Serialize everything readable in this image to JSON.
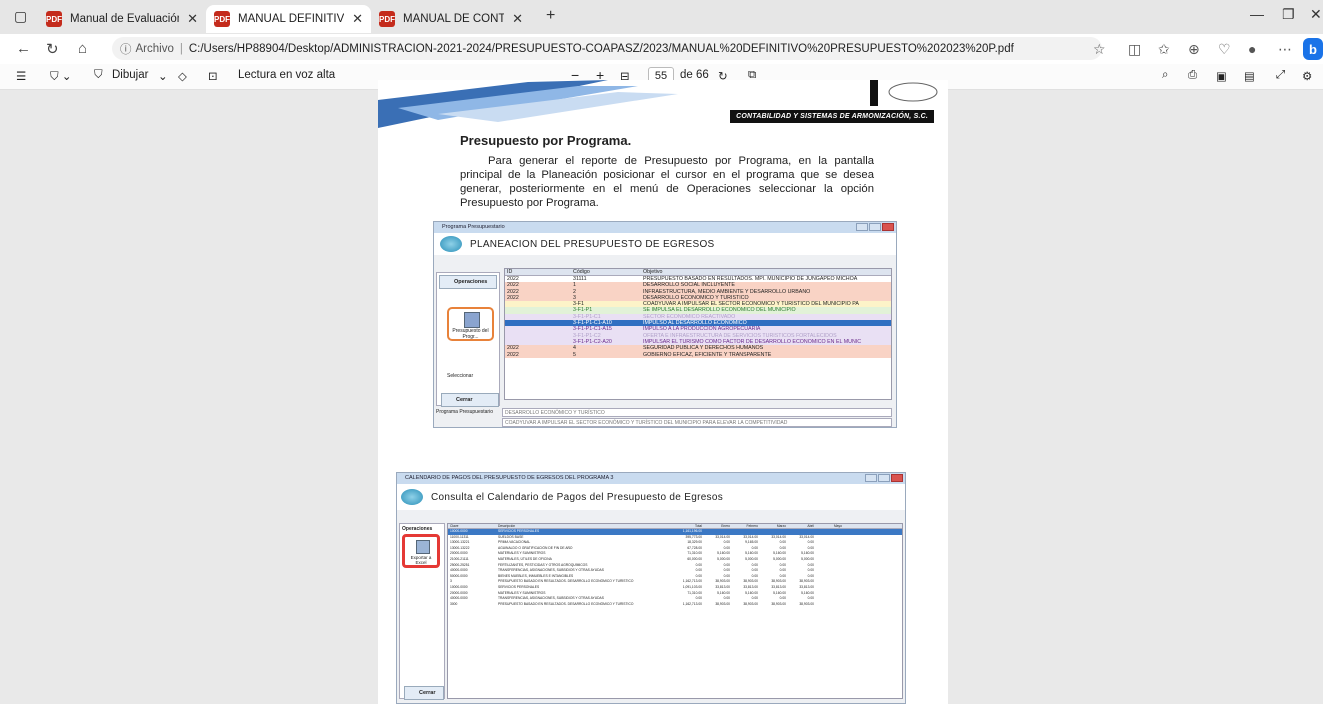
{
  "browser": {
    "tabs": [
      {
        "title": "Manual de Evaluación de Registr"
      },
      {
        "title": "MANUAL DEFINITIVO PRESUPUE"
      },
      {
        "title": "MANUAL DE CONTABILIDAD DE"
      }
    ],
    "new_tab": "+",
    "url_prefix": "Archivo",
    "url": "C:/Users/HP88904/Desktop/ADMINISTRACION-2021-2024/PRESUPUESTO-COAPASZ/2023/MANUAL%20DEFINITIVO%20PRESUPUESTO%202023%20P.pdf"
  },
  "pdf_toolbar": {
    "draw_label": "Dibujar",
    "read_aloud_label": "Lectura en voz alta",
    "zoom_out": "−",
    "zoom_in": "+",
    "current_page": "55",
    "page_total": "de 66"
  },
  "document": {
    "company_banner": "CONTABILIDAD Y SISTEMAS DE ARMONIZACIÓN, S.C.",
    "section_title": "Presupuesto por Programa.",
    "body": "Para generar el reporte de Presupuesto por Programa, en la pantalla principal de la Planeación posicionar el cursor en el programa que se desea generar, posteriormente en el menú de Operaciones seleccionar la opción Presupuesto por Programa."
  },
  "screenshot1": {
    "window_title": "Programa Presupuestario",
    "app_title": "PLANEACION DEL PRESUPUESTO DE EGRESOS",
    "side_operations": "Operaciones",
    "side_button": "Presupuesto del Progr...",
    "side_select": "Seleccionar",
    "side_close": "Cerrar",
    "columns": [
      "ID",
      "Código",
      "Objetivo"
    ],
    "rows": [
      {
        "id": "2022",
        "code": "31111",
        "obj": "PRESUPUESTO BASADO EN RESULTADOS. MPI. MUNICIPIO DE JUNGAPEO MICHOA",
        "bg": "#ffffff",
        "fg": "#222"
      },
      {
        "id": "2022",
        "code": "1",
        "obj": "DESARROLLO SOCIAL INCLUYENTE",
        "bg": "#f9d3c5",
        "fg": "#222"
      },
      {
        "id": "2022",
        "code": "2",
        "obj": "INFRAESTRUCTURA, MEDIO AMBIENTE Y DESARROLLO URBANO",
        "bg": "#f9d3c5",
        "fg": "#222"
      },
      {
        "id": "2022",
        "code": "3",
        "obj": "DESARROLLO ECONÓMICO Y TURÍSTICO",
        "bg": "#f9d3c5",
        "fg": "#222"
      },
      {
        "id": "",
        "code": "3-F1",
        "obj": "COADYUVAR A IMPULSAR EL SECTOR ECONÓMICO Y TURÍSTICO DEL MUNICIPIO PA",
        "bg": "#fdf3c8",
        "fg": "#222"
      },
      {
        "id": "",
        "code": "3-F1-P1",
        "obj": "SE IMPULSA EL DESARROLLO ECONÓMICO DEL MUNICIPIO",
        "bg": "#e2f2d8",
        "fg": "#2c7a2c"
      },
      {
        "id": "",
        "code": "3-F1-P1-C1",
        "obj": "SECTOR ECONÓMICO REACTIVADO",
        "bg": "#e9e0f4",
        "fg": "#b0a0c8"
      },
      {
        "id": "",
        "code": "3-F1-P1-C1-A10",
        "obj": "IMPULSO AL DESARROLLO ECONÓMICO",
        "bg": "#2f6fc1",
        "fg": "#ffffff"
      },
      {
        "id": "",
        "code": "3-F1-P1-C1-A15",
        "obj": "IMPULSO A LA PRODUCCIÓN AGROPECUARIA",
        "bg": "#e9e0f4",
        "fg": "#6a2c8c"
      },
      {
        "id": "",
        "code": "3-F1-P1-C2",
        "obj": "OFERTA E INFRAESTRUCTURA DE SERVICIOS TURÍSTICOS FORTALECIDOS",
        "bg": "#e9e0f4",
        "fg": "#b0a0c8"
      },
      {
        "id": "",
        "code": "3-F1-P1-C2-A20",
        "obj": "IMPULSAR EL TURISMO COMO FACTOR DE DESARROLLO ECONÓMICO EN EL MUNIC",
        "bg": "#e9e0f4",
        "fg": "#6a2c8c"
      },
      {
        "id": "2022",
        "code": "4",
        "obj": "SEGURIDAD PÚBLICA Y DERECHOS HUMANOS",
        "bg": "#f9d3c5",
        "fg": "#222"
      },
      {
        "id": "2022",
        "code": "5",
        "obj": "GOBIERNO EFICAZ, EFICIENTE Y TRANSPARENTE",
        "bg": "#f9d3c5",
        "fg": "#222"
      }
    ],
    "field_label": "Programa Presupuestario",
    "field_value": "DESARROLLO ECONÓMICO Y TURÍSTICO",
    "field2_value": "COADYUVAR A IMPULSAR EL SECTOR ECONÓMICO Y TURÍSTICO DEL MUNICIPIO PARA ELEVAR LA COMPETITIVIDAD"
  },
  "screenshot2": {
    "window_title": "CALENDARIO DE PAGOS DEL PRESUPUESTO DE EGRESOS DEL PROGRAMA 3",
    "app_title": "Consulta el Calendario de Pagos del Presupuesto de Egresos",
    "side_operations": "Operaciones",
    "export_label": "Exportar a Excel",
    "close_label": "Cerrar",
    "columns": [
      "Clave",
      "Descripción",
      "Total",
      "Enero",
      "Febrero",
      "Marzo",
      "Abril",
      "Mayo"
    ],
    "rows": [
      [
        "10000-0000",
        "SERVICIOS PERSONALES",
        "1,161,196.00",
        "",
        "",
        "",
        "",
        ""
      ],
      [
        "11000-11311",
        "SUELDOS BASE",
        "395,773.00",
        "33,014.00",
        "33,014.00",
        "33,014.00",
        "33,014.00",
        ""
      ],
      [
        "13000-13221",
        "PRIMA VACACIONAL",
        "18,329.00",
        "0.00",
        "9,165.00",
        "0.00",
        "0.00",
        ""
      ],
      [
        "13000-13222",
        "AGUINALDO O GRATIFICACIÓN DE FIN DE AÑO",
        "67,728.00",
        "0.00",
        "0.00",
        "0.00",
        "0.00",
        ""
      ],
      [
        "20000-0000",
        "MATERIALES Y SUMINISTROS",
        "71,310.00",
        "5,160.00",
        "5,160.00",
        "5,160.00",
        "5,160.00",
        ""
      ],
      [
        "21000-21111",
        "MATERIALES, ÚTILES DE OFICINA",
        "60,000.00",
        "5,000.00",
        "5,000.00",
        "5,000.00",
        "5,000.00",
        ""
      ],
      [
        "25000-25251",
        "FERTILIZANTES, PESTICIDAS Y OTROS AGROQUÍMICOS",
        "0.00",
        "0.00",
        "0.00",
        "0.00",
        "0.00",
        ""
      ],
      [
        "40000-0000",
        "TRANSFERENCIAS, ASIGNACIONES, SUBSIDIOS Y OTRAS AYUDAS",
        "0.00",
        "0.00",
        "0.00",
        "0.00",
        "0.00",
        ""
      ],
      [
        "50000-0000",
        "BIENES MUEBLES, INMUEBLES E INTANGIBLES",
        "0.00",
        "0.00",
        "0.00",
        "0.00",
        "0.00",
        ""
      ],
      [
        "3",
        "PRESUPUESTO BASADO EN RESULTADOS. DESARROLLO ECONÓMICO Y TURÍSTICO",
        "1,162,713.00",
        "38,903.00",
        "38,903.00",
        "38,903.00",
        "38,903.00",
        ""
      ],
      [
        "10000-0000",
        "SERVICIOS PERSONALES",
        "1,091,103.00",
        "33,813.00",
        "33,813.00",
        "33,813.00",
        "33,813.00",
        ""
      ],
      [
        "20000-0000",
        "MATERIALES Y SUMINISTROS",
        "71,310.00",
        "5,160.00",
        "5,160.00",
        "5,160.00",
        "5,160.00",
        ""
      ],
      [
        "40000-0000",
        "TRANSFERENCIAS, ASIGNACIONES, SUBSIDIOS Y OTRAS AYUDAS",
        "0.00",
        "0.00",
        "0.00",
        "0.00",
        "0.00",
        ""
      ],
      [
        "3000",
        "PRESUPUESTO BASADO EN RESULTADOS. DESARROLLO ECONÓMICO Y TURÍSTICO",
        "1,162,713.00",
        "38,903.00",
        "38,903.00",
        "38,903.00",
        "38,903.00",
        ""
      ]
    ]
  }
}
